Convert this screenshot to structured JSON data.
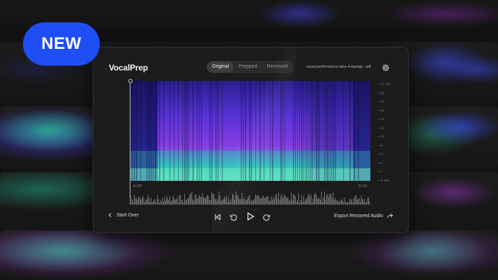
{
  "badge": {
    "label": "NEW"
  },
  "app": {
    "logo_part1": "VocalPr",
    "logo_part2": "ep",
    "tabs": [
      {
        "label": "Original",
        "active": true
      },
      {
        "label": "Prepped",
        "active": false
      },
      {
        "label": "Removed",
        "active": false
      }
    ],
    "filename": "vocal-performance-take-4-backgr...aiff",
    "time_start": "0:00",
    "time_end": "0:10",
    "scale_labels": [
      "22 kHz",
      "20",
      "18",
      "16",
      "14",
      "12",
      "10",
      "8",
      "6",
      "4",
      "2",
      "0 kHz"
    ],
    "start_over_label": "Start Over",
    "export_label": "Export Restored Audio"
  },
  "icons": {
    "settings": "gear-icon",
    "back": "chevron-left-icon",
    "skip_back": "skip-to-start-icon",
    "rewind": "rewind-icon",
    "play": "play-icon",
    "forward": "fast-forward-icon",
    "export": "share-icon"
  },
  "colors": {
    "badge": "#1f4ef5",
    "spec_low": "#2a1f8f",
    "spec_mid": "#6a35e6",
    "spec_high": "#3fe0c0"
  }
}
